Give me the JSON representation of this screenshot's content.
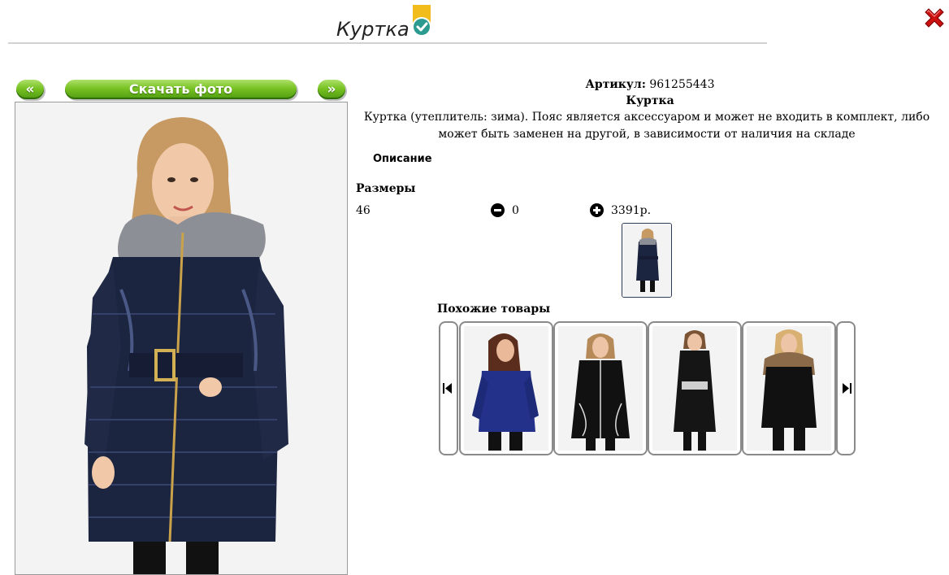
{
  "header": {
    "title": "Куртка",
    "badge_icon": "check-icon",
    "close_icon": "close-icon"
  },
  "gallery": {
    "prev_label": "«",
    "download_label": "Скачать фото",
    "next_label": "»"
  },
  "product": {
    "article_label": "Артикул:",
    "article_value": "961255443",
    "name": "Куртка",
    "description": "Куртка (утеплитель: зима). Пояс является аксессуаром и может не входить в комплект, либо может быть заменен на другой, в зависимости от наличия на складе",
    "description_link": "Описание"
  },
  "sizes": {
    "heading": "Размеры",
    "rows": [
      {
        "size": "46",
        "quantity": "0",
        "price": "3391р."
      }
    ]
  },
  "similar": {
    "heading": "Похожие товары"
  },
  "colors": {
    "accent_green": "#78c223",
    "jacket_navy": "#1c2540",
    "close_red": "#cc1111",
    "badge_yellow": "#f2bd1b"
  }
}
